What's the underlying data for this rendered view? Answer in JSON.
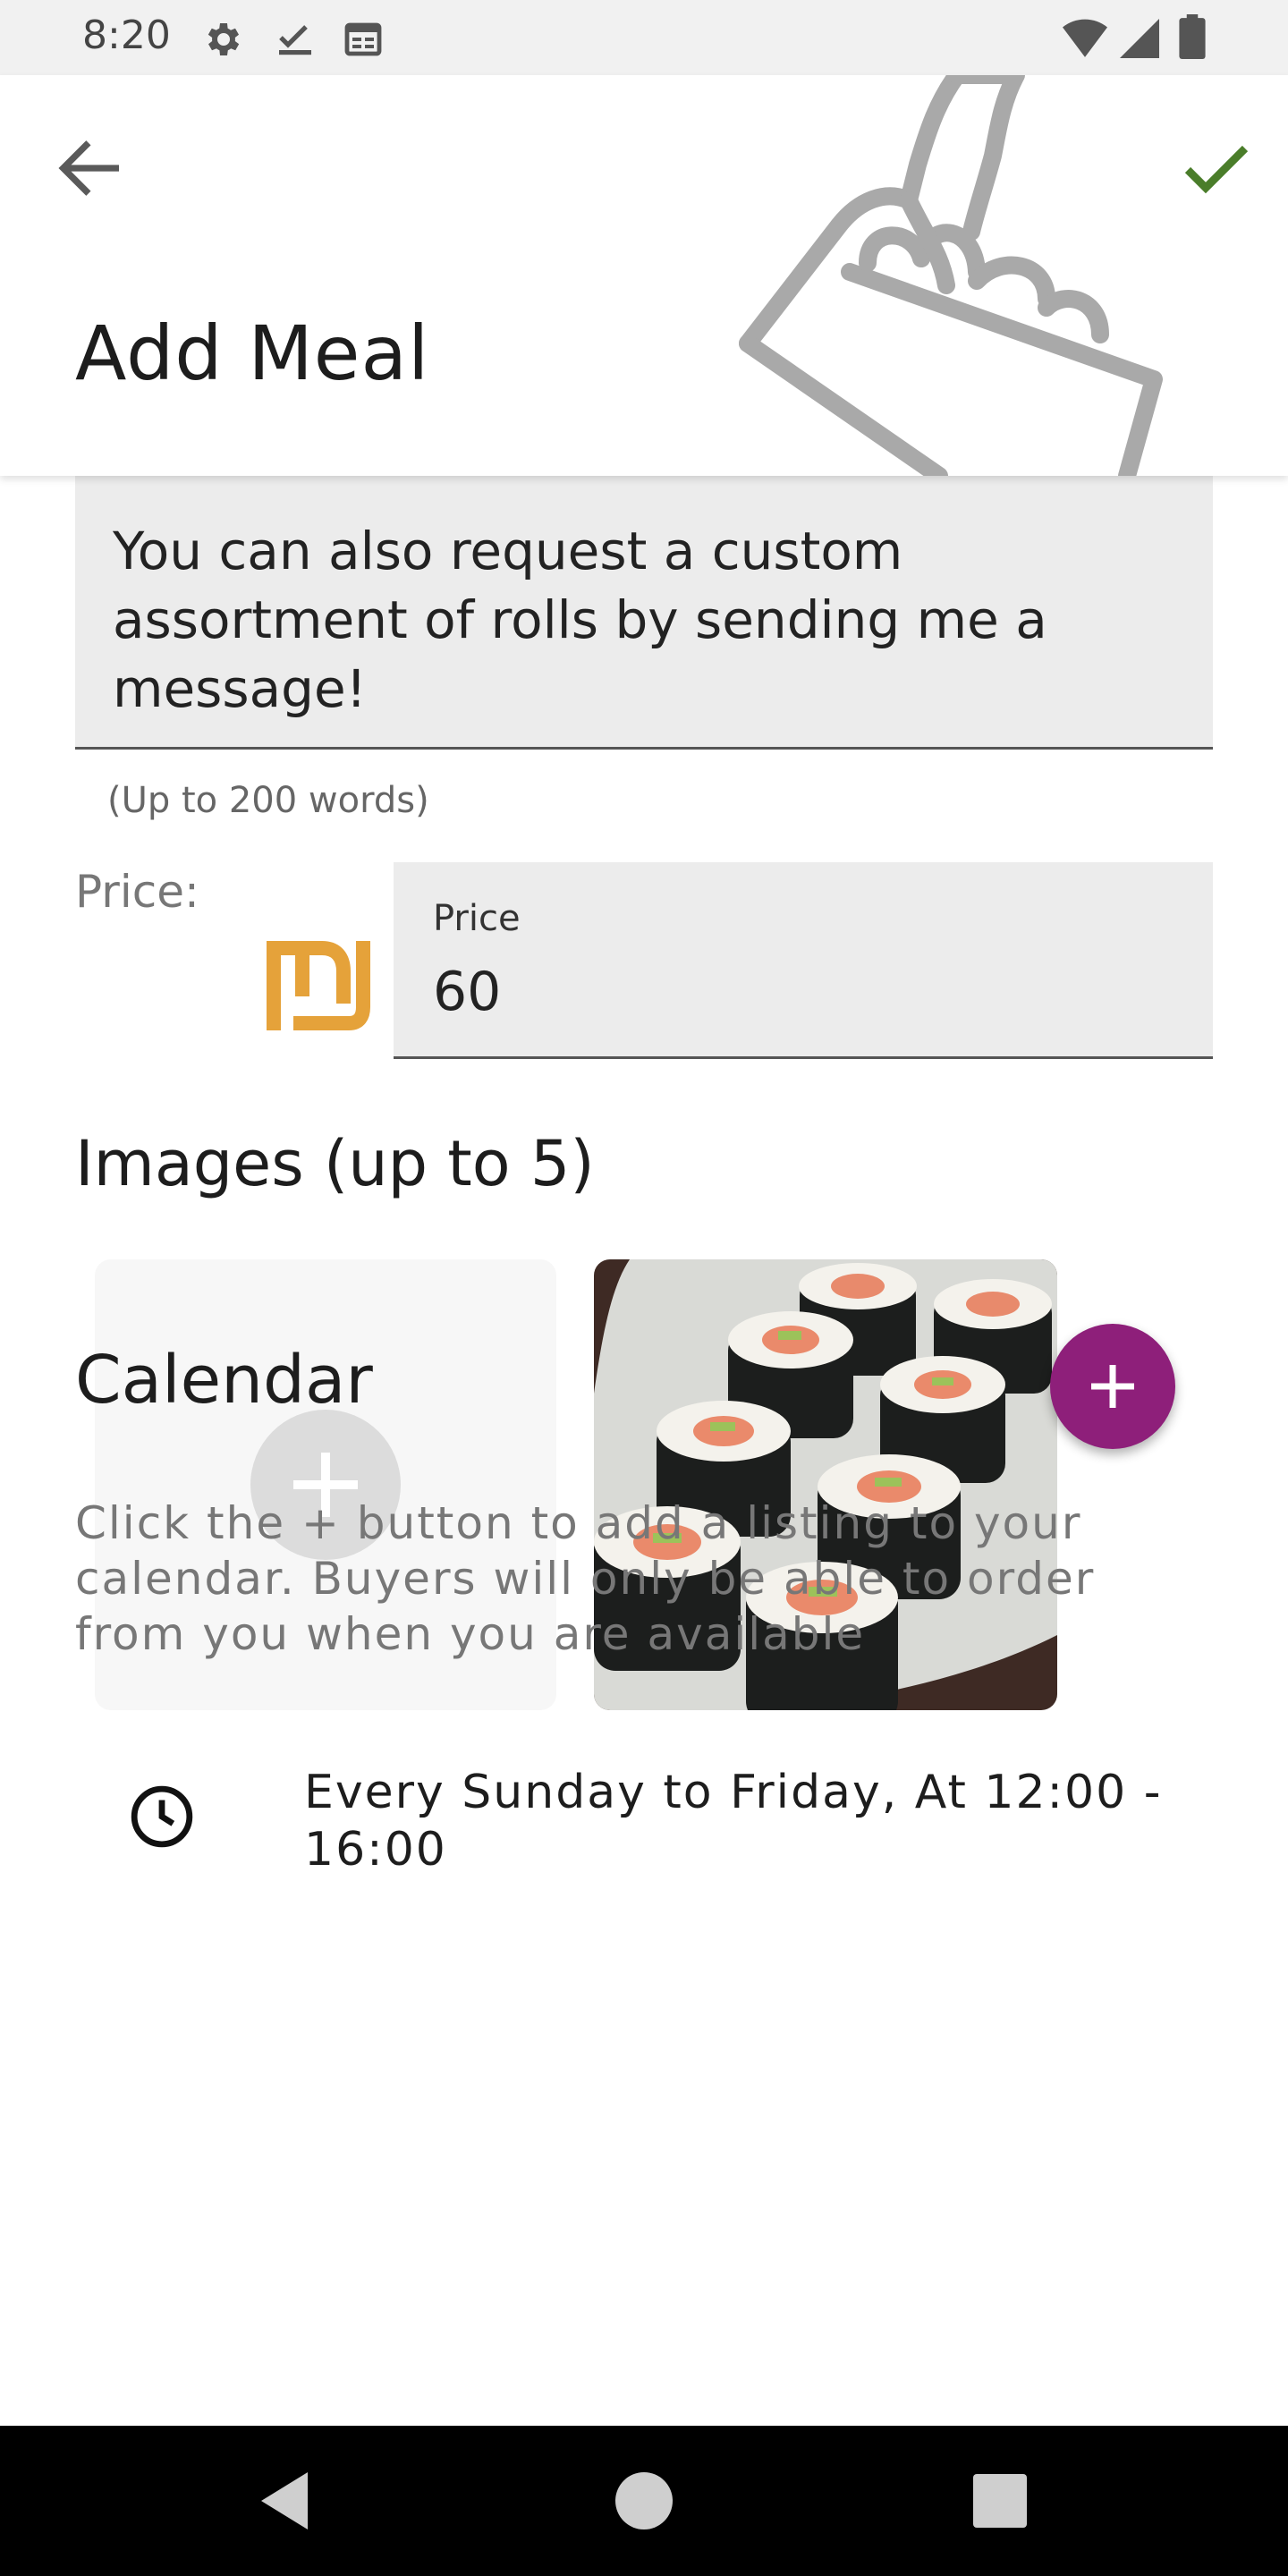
{
  "status_bar": {
    "time": "8:20",
    "left_icons": [
      "settings-icon",
      "check-download-icon",
      "calendar-icon"
    ],
    "right_icons": [
      "wifi-icon",
      "signal-icon",
      "battery-icon"
    ]
  },
  "app_bar": {
    "title": "Add Meal",
    "back_icon": "arrow-left-icon",
    "save_icon": "check-icon",
    "save_color": "#4a7d2a"
  },
  "form": {
    "description_value": "You can also request a custom assortment of rolls by sending me a message!",
    "description_helper": "(Up to 200 words)",
    "price_label": "Price:",
    "price_field_label": "Price",
    "price_value": "60",
    "currency_icon": "shekel-icon",
    "currency_color": "#e5a23a"
  },
  "images": {
    "title": "Images (up to 5)",
    "add_icon": "plus-icon",
    "items": [
      {
        "alt": "sushi rolls"
      }
    ]
  },
  "calendar": {
    "title": "Calendar",
    "help_text": "Click the + button to add a listing to your calendar. Buyers will only be able to order from you when you are available",
    "fab_color": "#8e1f7a",
    "entries": [
      {
        "icon": "clock-icon",
        "text": "Every Sunday to Friday, At 12:00 - 16:00"
      }
    ]
  },
  "nav_bar": {
    "buttons": [
      "back-triangle-icon",
      "home-circle-icon",
      "recents-square-icon"
    ]
  }
}
